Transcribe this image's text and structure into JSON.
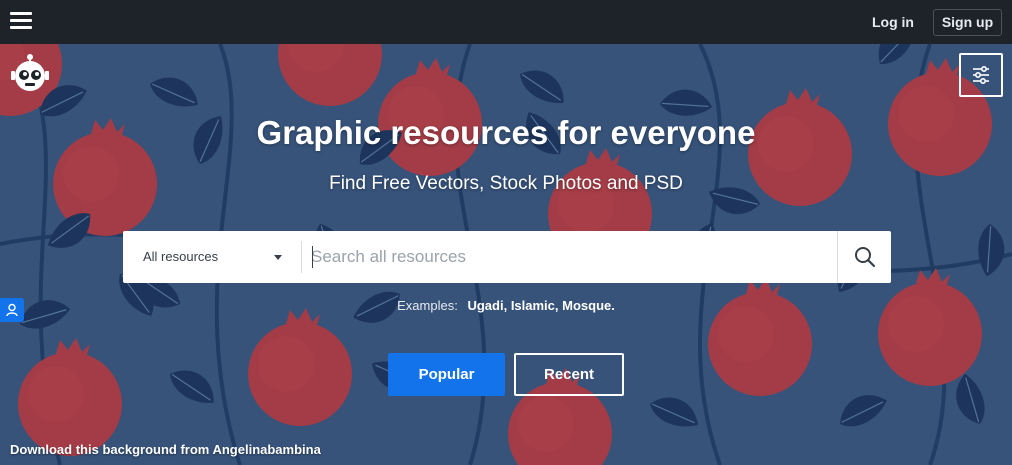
{
  "header": {
    "login_label": "Log in",
    "signup_label": "Sign up"
  },
  "hero": {
    "title": "Graphic resources for everyone",
    "subtitle": "Find Free Vectors, Stock Photos and PSD",
    "background_credit": "Download this background from Angelinabambina"
  },
  "search": {
    "resource_type_selected": "All resources",
    "placeholder": "Search all resources",
    "value": ""
  },
  "examples": {
    "label": "Examples:",
    "items": [
      "Ugadi,",
      "Islamic,",
      "Mosque."
    ]
  },
  "actions": {
    "popular_label": "Popular",
    "recent_label": "Recent"
  },
  "icons": {
    "menu": "hamburger-icon",
    "logo": "robot-logo-icon",
    "filters": "sliders-icon",
    "search": "search-icon",
    "feedback": "user-feedback-icon"
  },
  "colors": {
    "topbar": "#1e2329",
    "hero_background": "#3d5c86",
    "fruit": "#b8414a",
    "leaf": "#1f3a63",
    "primary_button": "#1273eb"
  }
}
